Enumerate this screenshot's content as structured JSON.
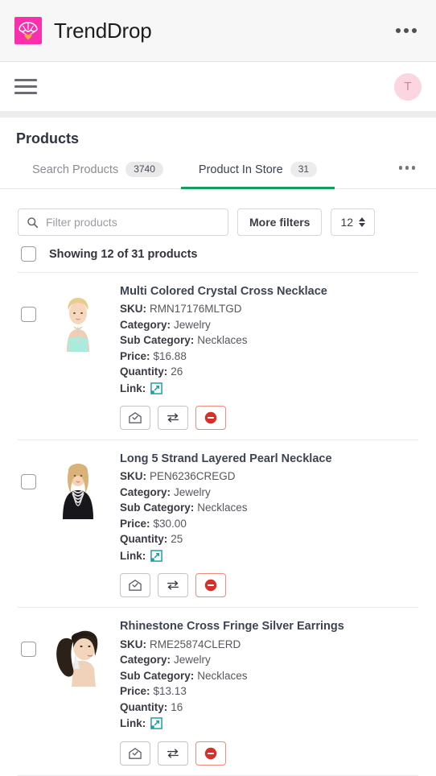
{
  "appbar": {
    "title": "TrendDrop",
    "logo_icon": "parachute-heart-logo",
    "logo_color": "#f92fae",
    "overflow_icon": "overflow-menu-icon"
  },
  "navbar": {
    "menu_icon": "hamburger-menu-icon",
    "avatar_initial": "T",
    "avatar_color": "#fbd5e0"
  },
  "page": {
    "title": "Products"
  },
  "tabs": {
    "accent_color": "#169b62",
    "items": [
      {
        "label": "Search Products",
        "count": "3740",
        "active": false
      },
      {
        "label": "Product In Store",
        "count": "31",
        "active": true
      }
    ],
    "more_icon": "tabs-overflow-icon"
  },
  "toolbar": {
    "search_placeholder": "Filter products",
    "search_value": "",
    "search_icon": "search-icon",
    "more_filters_label": "More filters",
    "page_size_value": "12",
    "page_size_icon": "stepper-icon"
  },
  "showing": {
    "select_all_icon": "select-all-checkbox",
    "text": "Showing 12 of 31 products"
  },
  "labels": {
    "sku": "SKU:",
    "category": "Category:",
    "sub_category": "Sub Category:",
    "price": "Price:",
    "quantity": "Quantity:",
    "link": "Link:",
    "link_icon": "external-link-icon",
    "action_store_icon": "store-check-icon",
    "action_sync_icon": "transfer-arrows-icon",
    "action_remove_icon": "remove-circle-icon"
  },
  "products": [
    {
      "title": "Multi Colored Crystal Cross Necklace",
      "sku": "RMN17176MLTGD",
      "category": "Jewelry",
      "sub_category": "Necklaces",
      "price": "$16.88",
      "quantity": "26",
      "thumb": "blonde-woman-mint-top"
    },
    {
      "title": "Long 5 Strand Layered Pearl Necklace",
      "sku": "PEN6236CREGD",
      "category": "Jewelry",
      "sub_category": "Necklaces",
      "price": "$30.00",
      "quantity": "25",
      "thumb": "blonde-woman-black-outfit"
    },
    {
      "title": "Rhinestone Cross Fringe Silver Earrings",
      "sku": "RME25874CLERD",
      "category": "Jewelry",
      "sub_category": "Necklaces",
      "price": "$13.13",
      "quantity": "16",
      "thumb": "dark-hair-woman-earrings"
    }
  ]
}
